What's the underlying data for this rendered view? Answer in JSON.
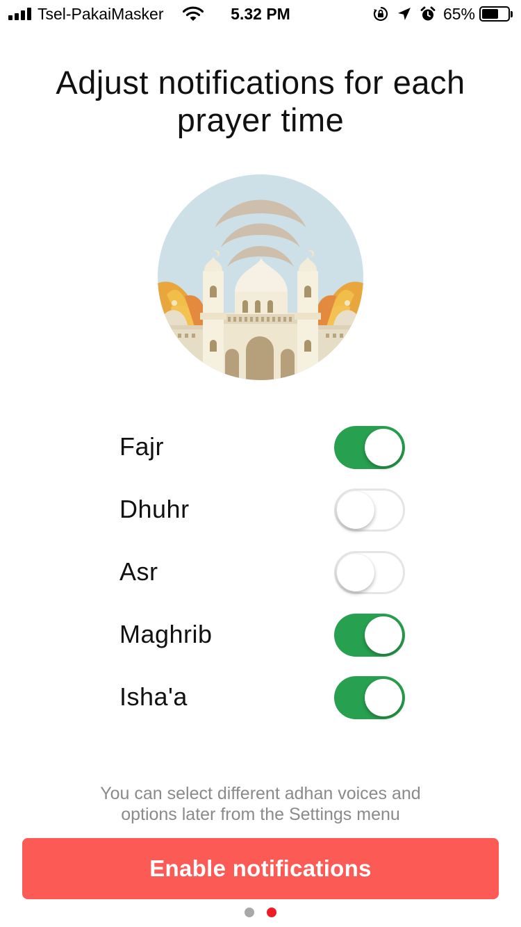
{
  "status_bar": {
    "carrier": "Tsel-PakaiMasker",
    "time": "5.32 PM",
    "battery_percent": "65%",
    "battery_level": 0.65,
    "signal_bars": 4,
    "icons": [
      "signal-icon",
      "wifi-icon",
      "orientation-lock-icon",
      "location-arrow-icon",
      "alarm-icon",
      "battery-icon"
    ]
  },
  "page": {
    "title_line1": "Adjust notifications for each",
    "title_line2": "prayer time",
    "illustration": "mosque-illustration"
  },
  "prayers": [
    {
      "name": "Fajr",
      "enabled": true
    },
    {
      "name": "Dhuhr",
      "enabled": false
    },
    {
      "name": "Asr",
      "enabled": false
    },
    {
      "name": "Maghrib",
      "enabled": true
    },
    {
      "name": "Isha'a",
      "enabled": true
    }
  ],
  "footer": {
    "note_line1": "You can select different adhan voices and",
    "note_line2": "options later from the Settings menu",
    "button_label": "Enable notifications"
  },
  "pagination": {
    "total": 2,
    "current": 2
  },
  "colors": {
    "toggle_on": "#27a04f",
    "toggle_off_border": "#e5e5e5",
    "button": "#fc5a55",
    "dot_active": "#ee1c24",
    "dot_inactive": "#a8a8a8",
    "sky": "#cde0e8"
  }
}
